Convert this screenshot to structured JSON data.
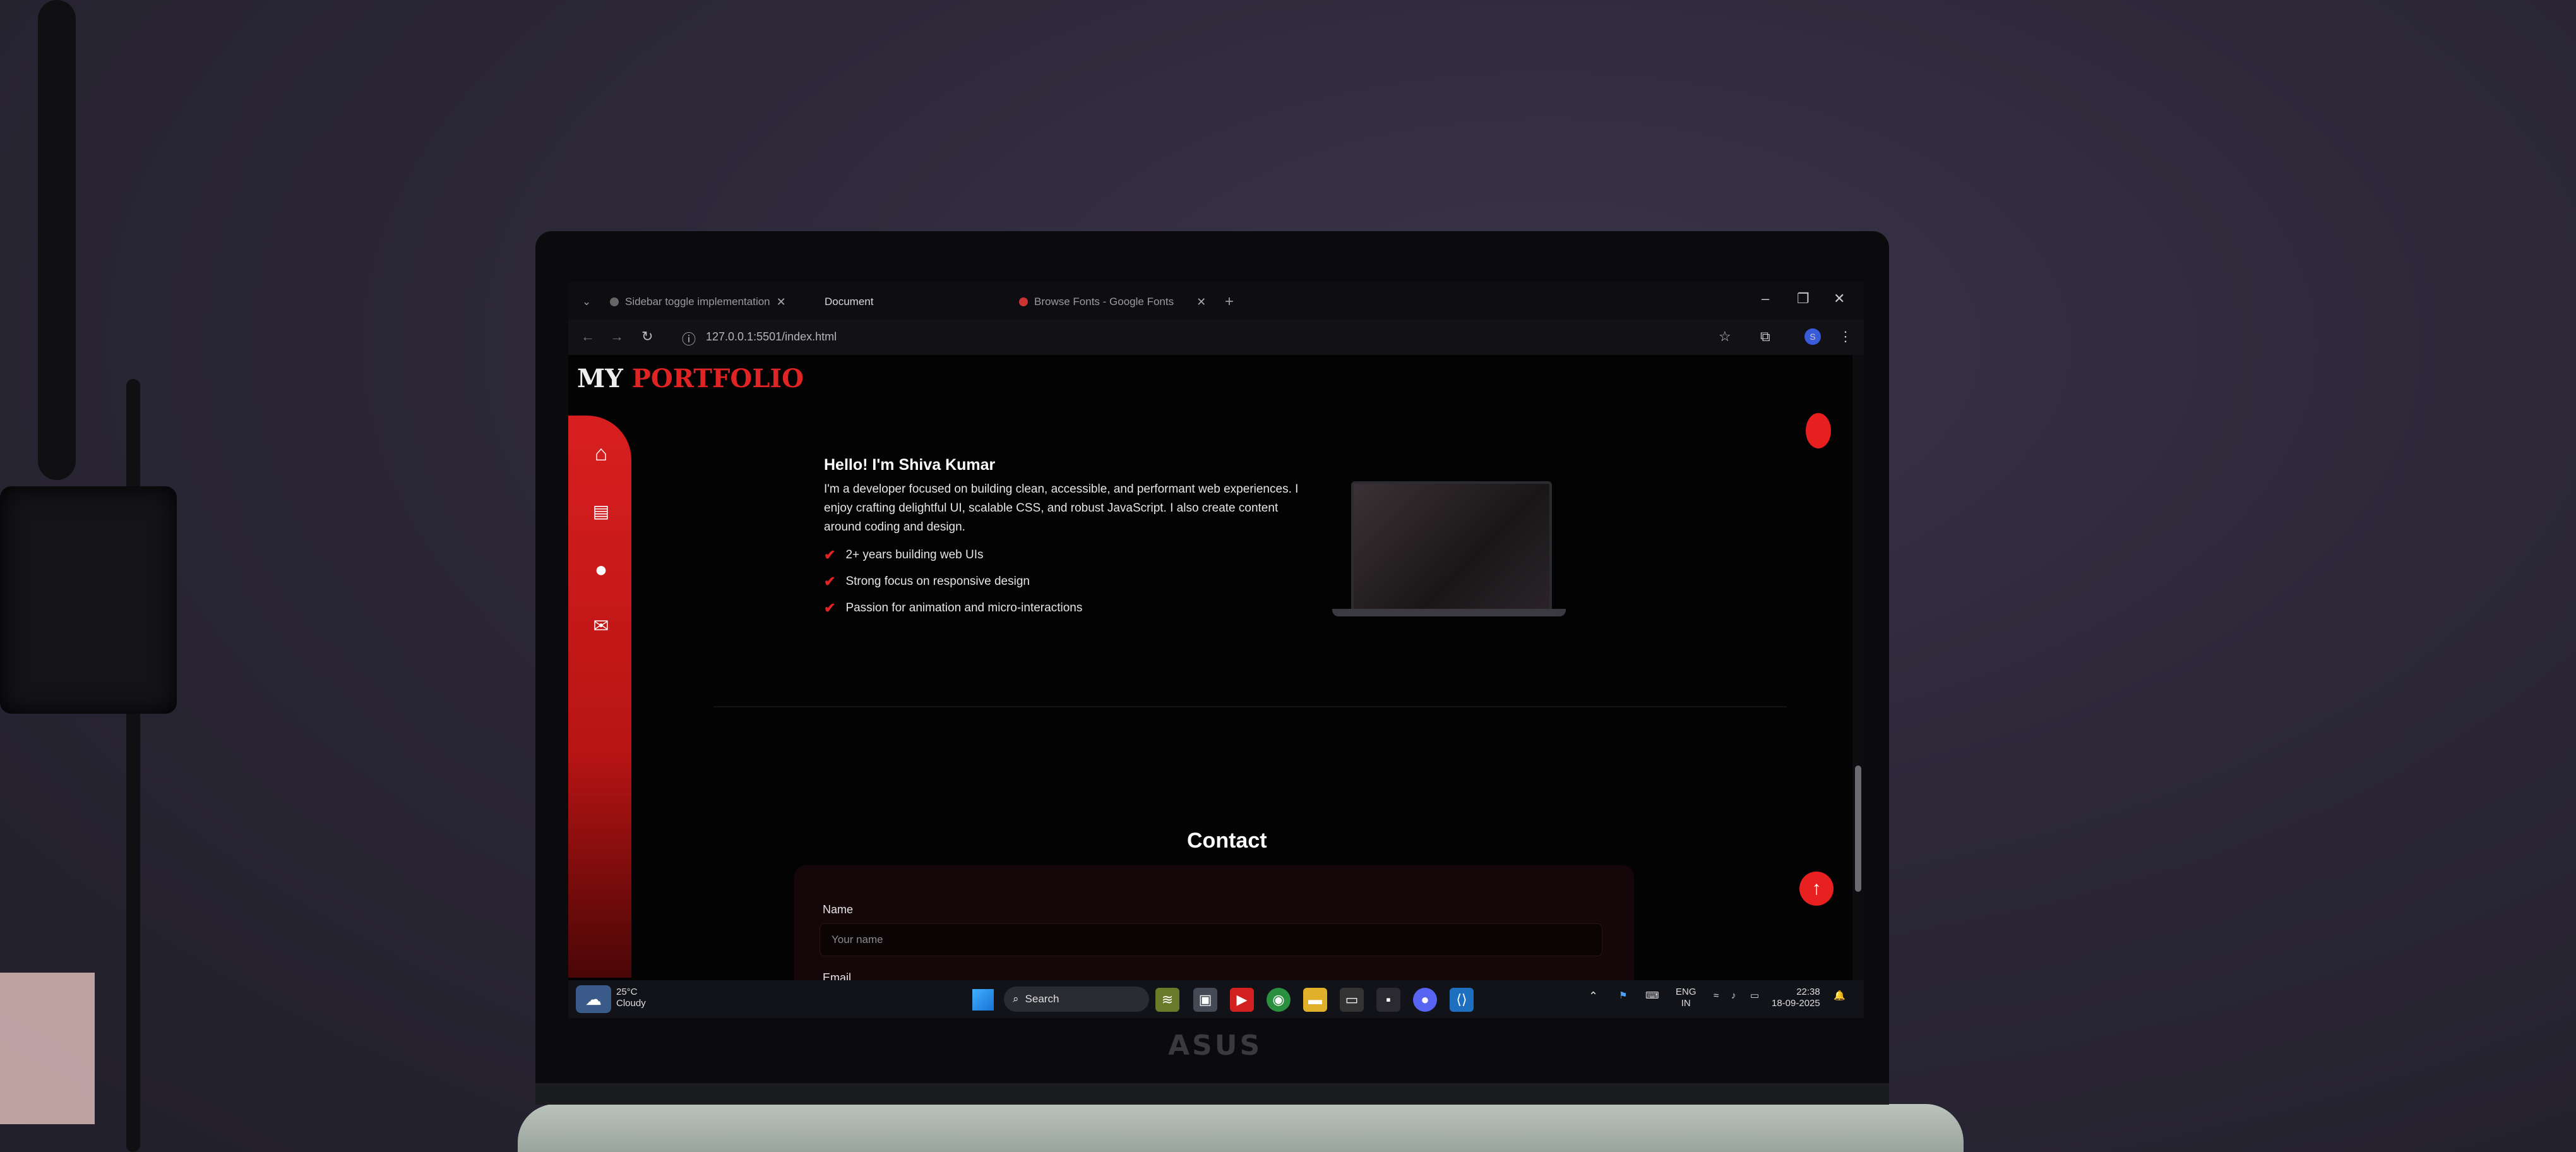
{
  "browser": {
    "tabs": [
      {
        "label": "Sidebar toggle implementation",
        "active": false
      },
      {
        "label": "Document",
        "active": true
      },
      {
        "label": "Browse Fonts - Google Fonts",
        "active": false
      }
    ],
    "new_tab": "+",
    "url": "127.0.0.1:5501/index.html",
    "window_controls": {
      "minimize": "–",
      "restore": "❐",
      "close": "✕"
    }
  },
  "site": {
    "logo_my": "MY",
    "logo_portfolio": "PORTFOLIO",
    "sidebar_icons": [
      "home-icon",
      "projects-icon",
      "user-icon",
      "mail-icon"
    ],
    "hero": {
      "title": "Hello! I'm Shiva Kumar",
      "text": "I'm a developer focused on building clean, accessible, and performant web experiences. I enjoy crafting delightful UI, scalable CSS, and robust JavaScript. I also create content around coding and design.",
      "features": [
        "2+ years building web UIs",
        "Strong focus on responsive design",
        "Passion for animation and micro-interactions"
      ]
    },
    "contact": {
      "title": "Contact",
      "name_label": "Name",
      "name_placeholder": "Your name",
      "email_label": "Email"
    }
  },
  "taskbar": {
    "temperature": "25°C",
    "weather": "Cloudy",
    "search_label": "Search",
    "lang_top": "ENG",
    "lang_bottom": "IN",
    "time": "22:38",
    "date": "18-09-2025"
  },
  "laptop_brand": "ASUS",
  "colors": {
    "accent": "#e02424",
    "sidebar": "#d81f1f",
    "page_bg": "#030304"
  }
}
